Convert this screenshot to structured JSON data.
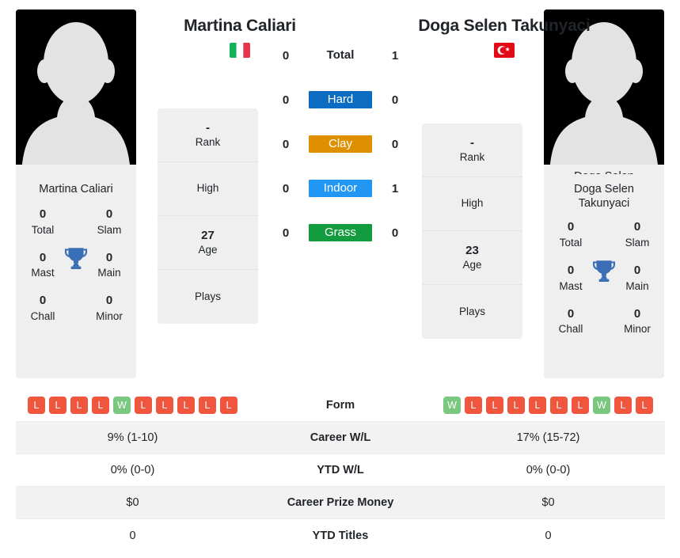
{
  "players": {
    "left": {
      "name": "Martina Caliari",
      "photo_caption": "Martina Caliari",
      "flag": "italy-flag",
      "rank": "-",
      "rank_label": "Rank",
      "high": "",
      "high_label": "High",
      "age": "27",
      "age_label": "Age",
      "plays": "",
      "plays_label": "Plays",
      "titles_heading": "Martina Caliari",
      "titles": {
        "total": "0",
        "total_label": "Total",
        "slam": "0",
        "slam_label": "Slam",
        "mast": "0",
        "mast_label": "Mast",
        "main": "0",
        "main_label": "Main",
        "chall": "0",
        "chall_label": "Chall",
        "minor": "0",
        "minor_label": "Minor"
      },
      "h2h": {
        "total": "0",
        "hard": "0",
        "clay": "0",
        "indoor": "0",
        "grass": "0"
      },
      "form": [
        "L",
        "L",
        "L",
        "L",
        "W",
        "L",
        "L",
        "L",
        "L",
        "L"
      ],
      "career_wl": "9% (1-10)",
      "ytd_wl": "0% (0-0)",
      "career_prize_money": "$0",
      "ytd_titles": "0"
    },
    "right": {
      "name": "Doga Selen Takunyaci",
      "photo_caption": "Doga Selen Takunyaci",
      "flag": "turkey-flag",
      "rank": "-",
      "rank_label": "Rank",
      "high": "",
      "high_label": "High",
      "age": "23",
      "age_label": "Age",
      "plays": "",
      "plays_label": "Plays",
      "titles_heading": "Doga Selen Takunyaci",
      "titles": {
        "total": "0",
        "total_label": "Total",
        "slam": "0",
        "slam_label": "Slam",
        "mast": "0",
        "mast_label": "Mast",
        "main": "0",
        "main_label": "Main",
        "chall": "0",
        "chall_label": "Chall",
        "minor": "0",
        "minor_label": "Minor"
      },
      "h2h": {
        "total": "1",
        "hard": "0",
        "clay": "0",
        "indoor": "1",
        "grass": "0"
      },
      "form": [
        "W",
        "L",
        "L",
        "L",
        "L",
        "L",
        "L",
        "W",
        "L",
        "L"
      ],
      "career_wl": "17% (15-72)",
      "ytd_wl": "0% (0-0)",
      "career_prize_money": "$0",
      "ytd_titles": "0"
    }
  },
  "surfaces": [
    {
      "key": "total",
      "label": "Total",
      "badge": false,
      "color": ""
    },
    {
      "key": "hard",
      "label": "Hard",
      "badge": true,
      "color": "#0b6cc2"
    },
    {
      "key": "clay",
      "label": "Clay",
      "badge": true,
      "color": "#df9000"
    },
    {
      "key": "indoor",
      "label": "Indoor",
      "badge": true,
      "color": "#2196f3"
    },
    {
      "key": "grass",
      "label": "Grass",
      "badge": true,
      "color": "#129b3f"
    }
  ],
  "table_rows": [
    {
      "label": "Form",
      "kind": "form",
      "shaded": false
    },
    {
      "label": "Career W/L",
      "kind": "text",
      "shaded": true,
      "field": "career_wl"
    },
    {
      "label": "YTD W/L",
      "kind": "text",
      "shaded": false,
      "field": "ytd_wl"
    },
    {
      "label": "Career Prize Money",
      "kind": "text",
      "shaded": true,
      "field": "career_prize_money"
    },
    {
      "label": "YTD Titles",
      "kind": "text",
      "shaded": false,
      "field": "ytd_titles"
    }
  ],
  "colors": {
    "win": "#7ac77f",
    "loss": "#f0563e",
    "panel": "#efefef",
    "row_shade": "#f2f2f2",
    "trophy": "#3b6fb5",
    "text": "#212529"
  }
}
